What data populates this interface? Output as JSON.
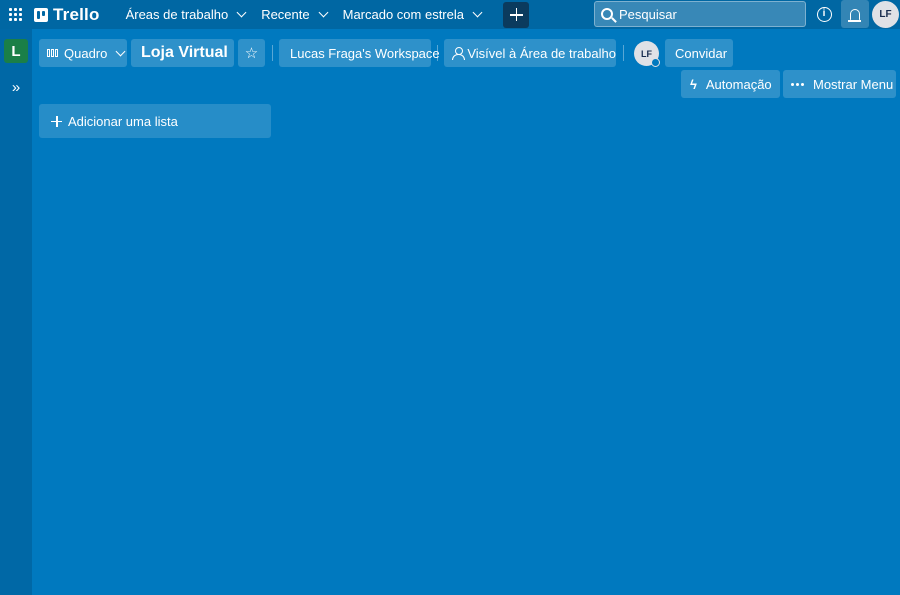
{
  "topbar": {
    "logo_text": "Trello",
    "nav": [
      {
        "label": "Áreas de trabalho"
      },
      {
        "label": "Recente"
      },
      {
        "label": "Marcado com estrela"
      }
    ],
    "search_placeholder": "Pesquisar",
    "info_symbol": "i",
    "user_initials": "LF"
  },
  "sidebar": {
    "workspace_initial": "L",
    "expand_symbol": "»"
  },
  "board": {
    "view_label": "Quadro",
    "title": "Loja Virtual",
    "star_symbol": "☆",
    "workspace_label": "Lucas Fraga's Workspace",
    "visibility_label": "Visível à Área de trabalho",
    "member_initials": "LF",
    "invite_label": "Convidar",
    "automation_symbol": "ϟ",
    "automation_label": "Automação",
    "menu_label": "Mostrar Menu",
    "add_list_label": "Adicionar uma lista"
  },
  "colors": {
    "board_background": "#0079bf",
    "topbar": "#0067a3",
    "workspace_badge": "#1a7f47"
  },
  "icons": [
    "apps-grid-icon",
    "trello-logo-icon",
    "chevron-down-icon",
    "plus-icon",
    "search-icon",
    "info-icon",
    "bell-icon",
    "board-view-icon",
    "star-icon",
    "people-icon",
    "bolt-icon",
    "dots-icon",
    "expand-icon"
  ]
}
